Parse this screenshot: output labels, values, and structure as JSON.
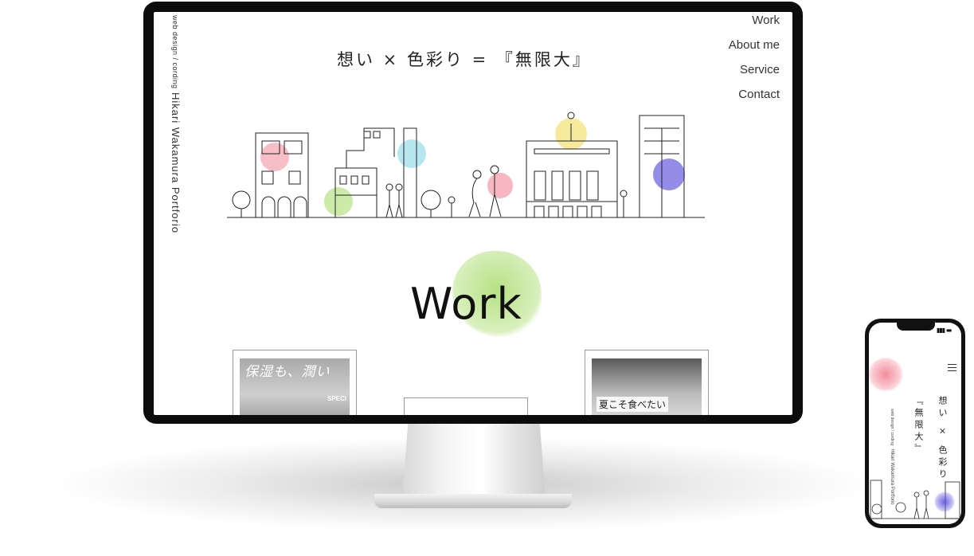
{
  "site": {
    "logo_sub": "web design / cording",
    "logo_main": "Hikari Wakamura Portforio",
    "tagline": "想い × 色彩り = 『無限大』"
  },
  "nav": {
    "items": [
      {
        "label": "Work"
      },
      {
        "label": "About me"
      },
      {
        "label": "Service"
      },
      {
        "label": "Contact"
      }
    ]
  },
  "work": {
    "heading": "Work",
    "cards": [
      {
        "title": "保湿も、潤い",
        "badge": "SPECI"
      },
      {
        "title": ""
      },
      {
        "title": "夏こそ食べたい"
      }
    ]
  },
  "phone": {
    "status": "▮▮▮ ▬",
    "tagline_part1": "想い × 色彩り",
    "tagline_part2": "『無限大』",
    "logo_sub": "web design / cording",
    "logo_main": "Hikari Wakamura Portforio"
  },
  "colors": {
    "frame": "#0c0c0c",
    "accent_green": "#aadc6e",
    "accent_pink": "#f06e82",
    "accent_blue": "#5a50dc",
    "accent_yellow": "#f0d84a",
    "accent_cyan": "#6ecfe0"
  }
}
